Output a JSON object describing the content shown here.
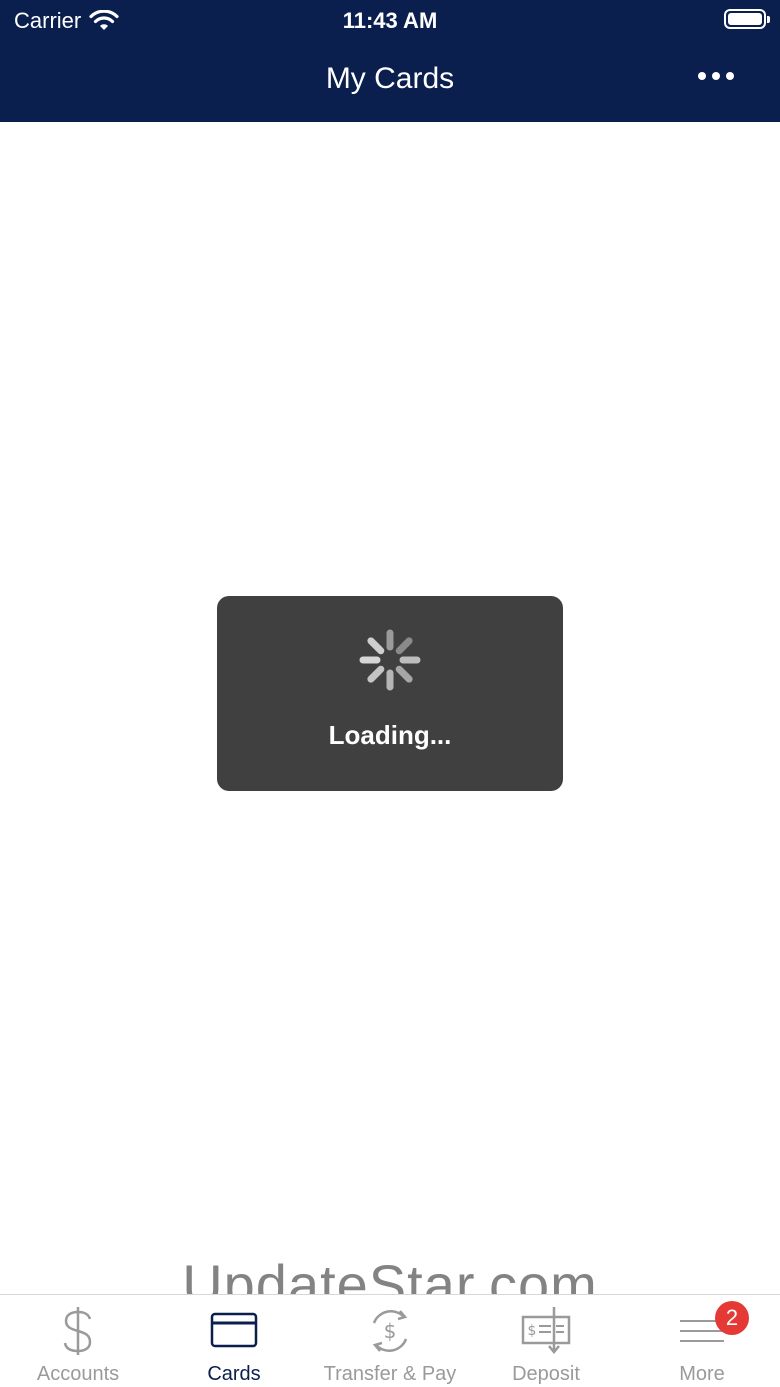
{
  "status_bar": {
    "carrier": "Carrier",
    "time": "11:43 AM"
  },
  "header": {
    "title": "My Cards",
    "menu_icon": "more-horizontal-icon"
  },
  "loading": {
    "text": "Loading..."
  },
  "watermark": {
    "text": "UpdateStar.com"
  },
  "tabs": [
    {
      "label": "Accounts",
      "icon": "dollar-icon",
      "active": false
    },
    {
      "label": "Cards",
      "icon": "credit-card-icon",
      "active": true
    },
    {
      "label": "Transfer & Pay",
      "icon": "transfer-icon",
      "active": false
    },
    {
      "label": "Deposit",
      "icon": "check-deposit-icon",
      "active": false
    },
    {
      "label": "More",
      "icon": "menu-lines-icon",
      "active": false,
      "badge": "2"
    }
  ],
  "colors": {
    "header_bg": "#0b1f4f",
    "active_tab": "#0b1f4f",
    "inactive_tab": "#9a9a9a",
    "badge": "#e53935",
    "loading_bg": "#404040"
  }
}
